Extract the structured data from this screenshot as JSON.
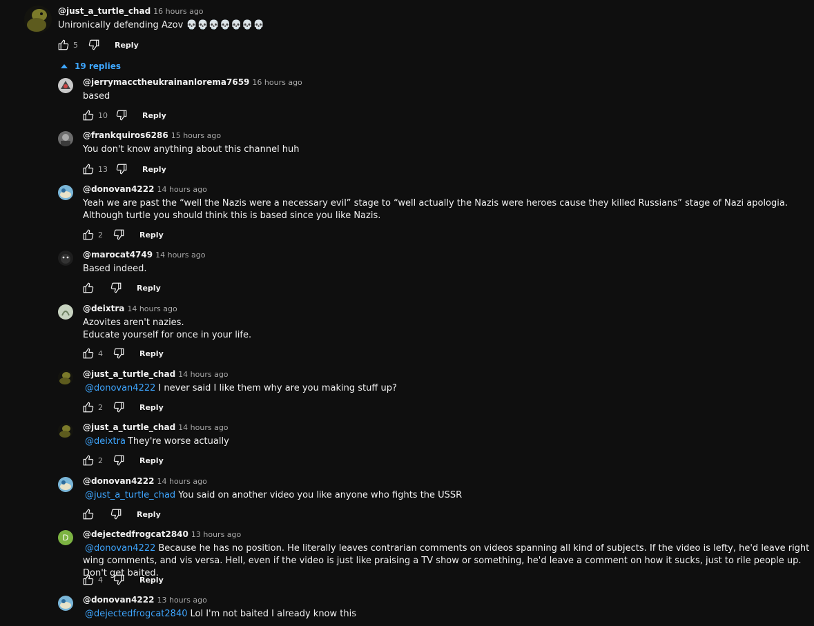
{
  "top_comment": {
    "author": "@just_a_turtle_chad",
    "time": "16 hours ago",
    "text": "Unironically defending Azov 💀💀💀💀💀💀💀",
    "likes": "5",
    "reply_label": "Reply"
  },
  "replies_toggle": "19 replies",
  "replies": [
    {
      "author": "@jerrymacctheukrainanlorema7659",
      "time": "16 hours ago",
      "mention": "",
      "text": "based",
      "likes": "10",
      "reply_label": "Reply"
    },
    {
      "author": "@frankquiros6286",
      "time": "15 hours ago",
      "mention": "",
      "text": "You don't know anything about this channel huh",
      "likes": "13",
      "reply_label": "Reply"
    },
    {
      "author": "@donovan4222",
      "time": "14 hours ago",
      "mention": "",
      "text": "Yeah we are past the “well the Nazis were a necessary evil” stage to “well actually the Nazis were heroes cause they killed Russians” stage of Nazi apologia. Although turtle you should think this is based since you like Nazis.",
      "likes": "2",
      "reply_label": "Reply"
    },
    {
      "author": "@marocat4749",
      "time": "14 hours ago",
      "mention": "",
      "text": "Based indeed.",
      "likes": "",
      "reply_label": "Reply"
    },
    {
      "author": "@deixtra",
      "time": "14 hours ago",
      "mention": "",
      "text": "Azovites aren't nazies.",
      "text2": "Educate yourself for once in your life.",
      "likes": "4",
      "reply_label": "Reply"
    },
    {
      "author": "@just_a_turtle_chad",
      "time": "14 hours ago",
      "mention": "@donovan4222",
      "text": "I never said I like them why are you making stuff up?",
      "likes": "2",
      "reply_label": "Reply"
    },
    {
      "author": "@just_a_turtle_chad",
      "time": "14 hours ago",
      "mention": "@deixtra",
      "text": "They're worse actually",
      "likes": "2",
      "reply_label": "Reply"
    },
    {
      "author": "@donovan4222",
      "time": "14 hours ago",
      "mention": "@just_a_turtle_chad",
      "text": "You said on another video you like anyone who fights the USSR",
      "likes": "",
      "reply_label": "Reply"
    },
    {
      "author": "@dejectedfrogcat2840",
      "time": "13 hours ago",
      "mention": "@donovan4222",
      "text": "Because he has no position. He literally leaves contrarian comments on videos spanning all kind of subjects. If the video is lefty, he'd leave right wing comments, and vis versa. Hell, even if the video is just like praising a TV show or something, he'd leave a comment on how it sucks, just to rile people up. Don't get baited.",
      "likes": "4",
      "reply_label": "Reply",
      "avatar_letter": "D"
    },
    {
      "author": "@donovan4222",
      "time": "13 hours ago",
      "mention": "@dejectedfrogcat2840",
      "text": "Lol I'm not baited I already know this",
      "likes": "",
      "reply_label": "Reply"
    }
  ],
  "colors": {
    "background": "#0f0f0f",
    "mention": "#3ea6ff",
    "toggle": "#3ea6ff"
  }
}
